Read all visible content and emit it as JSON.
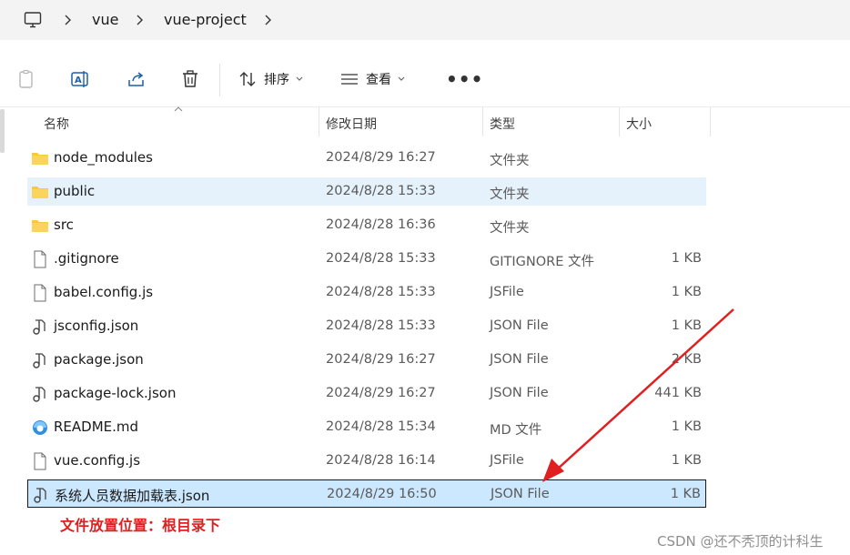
{
  "address": {
    "crumbs": [
      "vue",
      "vue-project"
    ]
  },
  "toolbar": {
    "sort_label": "排序",
    "view_label": "查看"
  },
  "columns": {
    "name": "名称",
    "date": "修改日期",
    "type": "类型",
    "size": "大小"
  },
  "rows": [
    {
      "name": "node_modules",
      "date": "2024/8/29 16:27",
      "type": "文件夹",
      "size": "",
      "icon": "folder-icon"
    },
    {
      "name": "public",
      "date": "2024/8/28 15:33",
      "type": "文件夹",
      "size": "",
      "icon": "folder-icon"
    },
    {
      "name": "src",
      "date": "2024/8/28 16:36",
      "type": "文件夹",
      "size": "",
      "icon": "folder-icon"
    },
    {
      "name": ".gitignore",
      "date": "2024/8/28 15:33",
      "type": "GITIGNORE 文件",
      "size": "1 KB",
      "icon": "file-icon"
    },
    {
      "name": "babel.config.js",
      "date": "2024/8/28 15:33",
      "type": "JSFile",
      "size": "1 KB",
      "icon": "file-icon"
    },
    {
      "name": "jsconfig.json",
      "date": "2024/8/28 15:33",
      "type": "JSON File",
      "size": "1 KB",
      "icon": "json-file-icon"
    },
    {
      "name": "package.json",
      "date": "2024/8/29 16:27",
      "type": "JSON File",
      "size": "2 KB",
      "icon": "json-file-icon"
    },
    {
      "name": "package-lock.json",
      "date": "2024/8/29 16:27",
      "type": "JSON File",
      "size": "441 KB",
      "icon": "json-file-icon"
    },
    {
      "name": "README.md",
      "date": "2024/8/28 15:34",
      "type": "MD 文件",
      "size": "1 KB",
      "icon": "markdown-file-icon"
    },
    {
      "name": "vue.config.js",
      "date": "2024/8/28 16:14",
      "type": "JSFile",
      "size": "1 KB",
      "icon": "file-icon"
    },
    {
      "name": "系统人员数据加载表.json",
      "date": "2024/8/29 16:50",
      "type": "JSON File",
      "size": "1 KB",
      "icon": "json-file-icon"
    }
  ],
  "annotation": "文件放置位置：根目录下",
  "watermark": "CSDN @还不秃顶的计科生",
  "colors": {
    "annotation": "#e02020",
    "selected_row": "#cce8ff",
    "hover_row": "#e5f1fb",
    "folder": "#f8c93e"
  }
}
